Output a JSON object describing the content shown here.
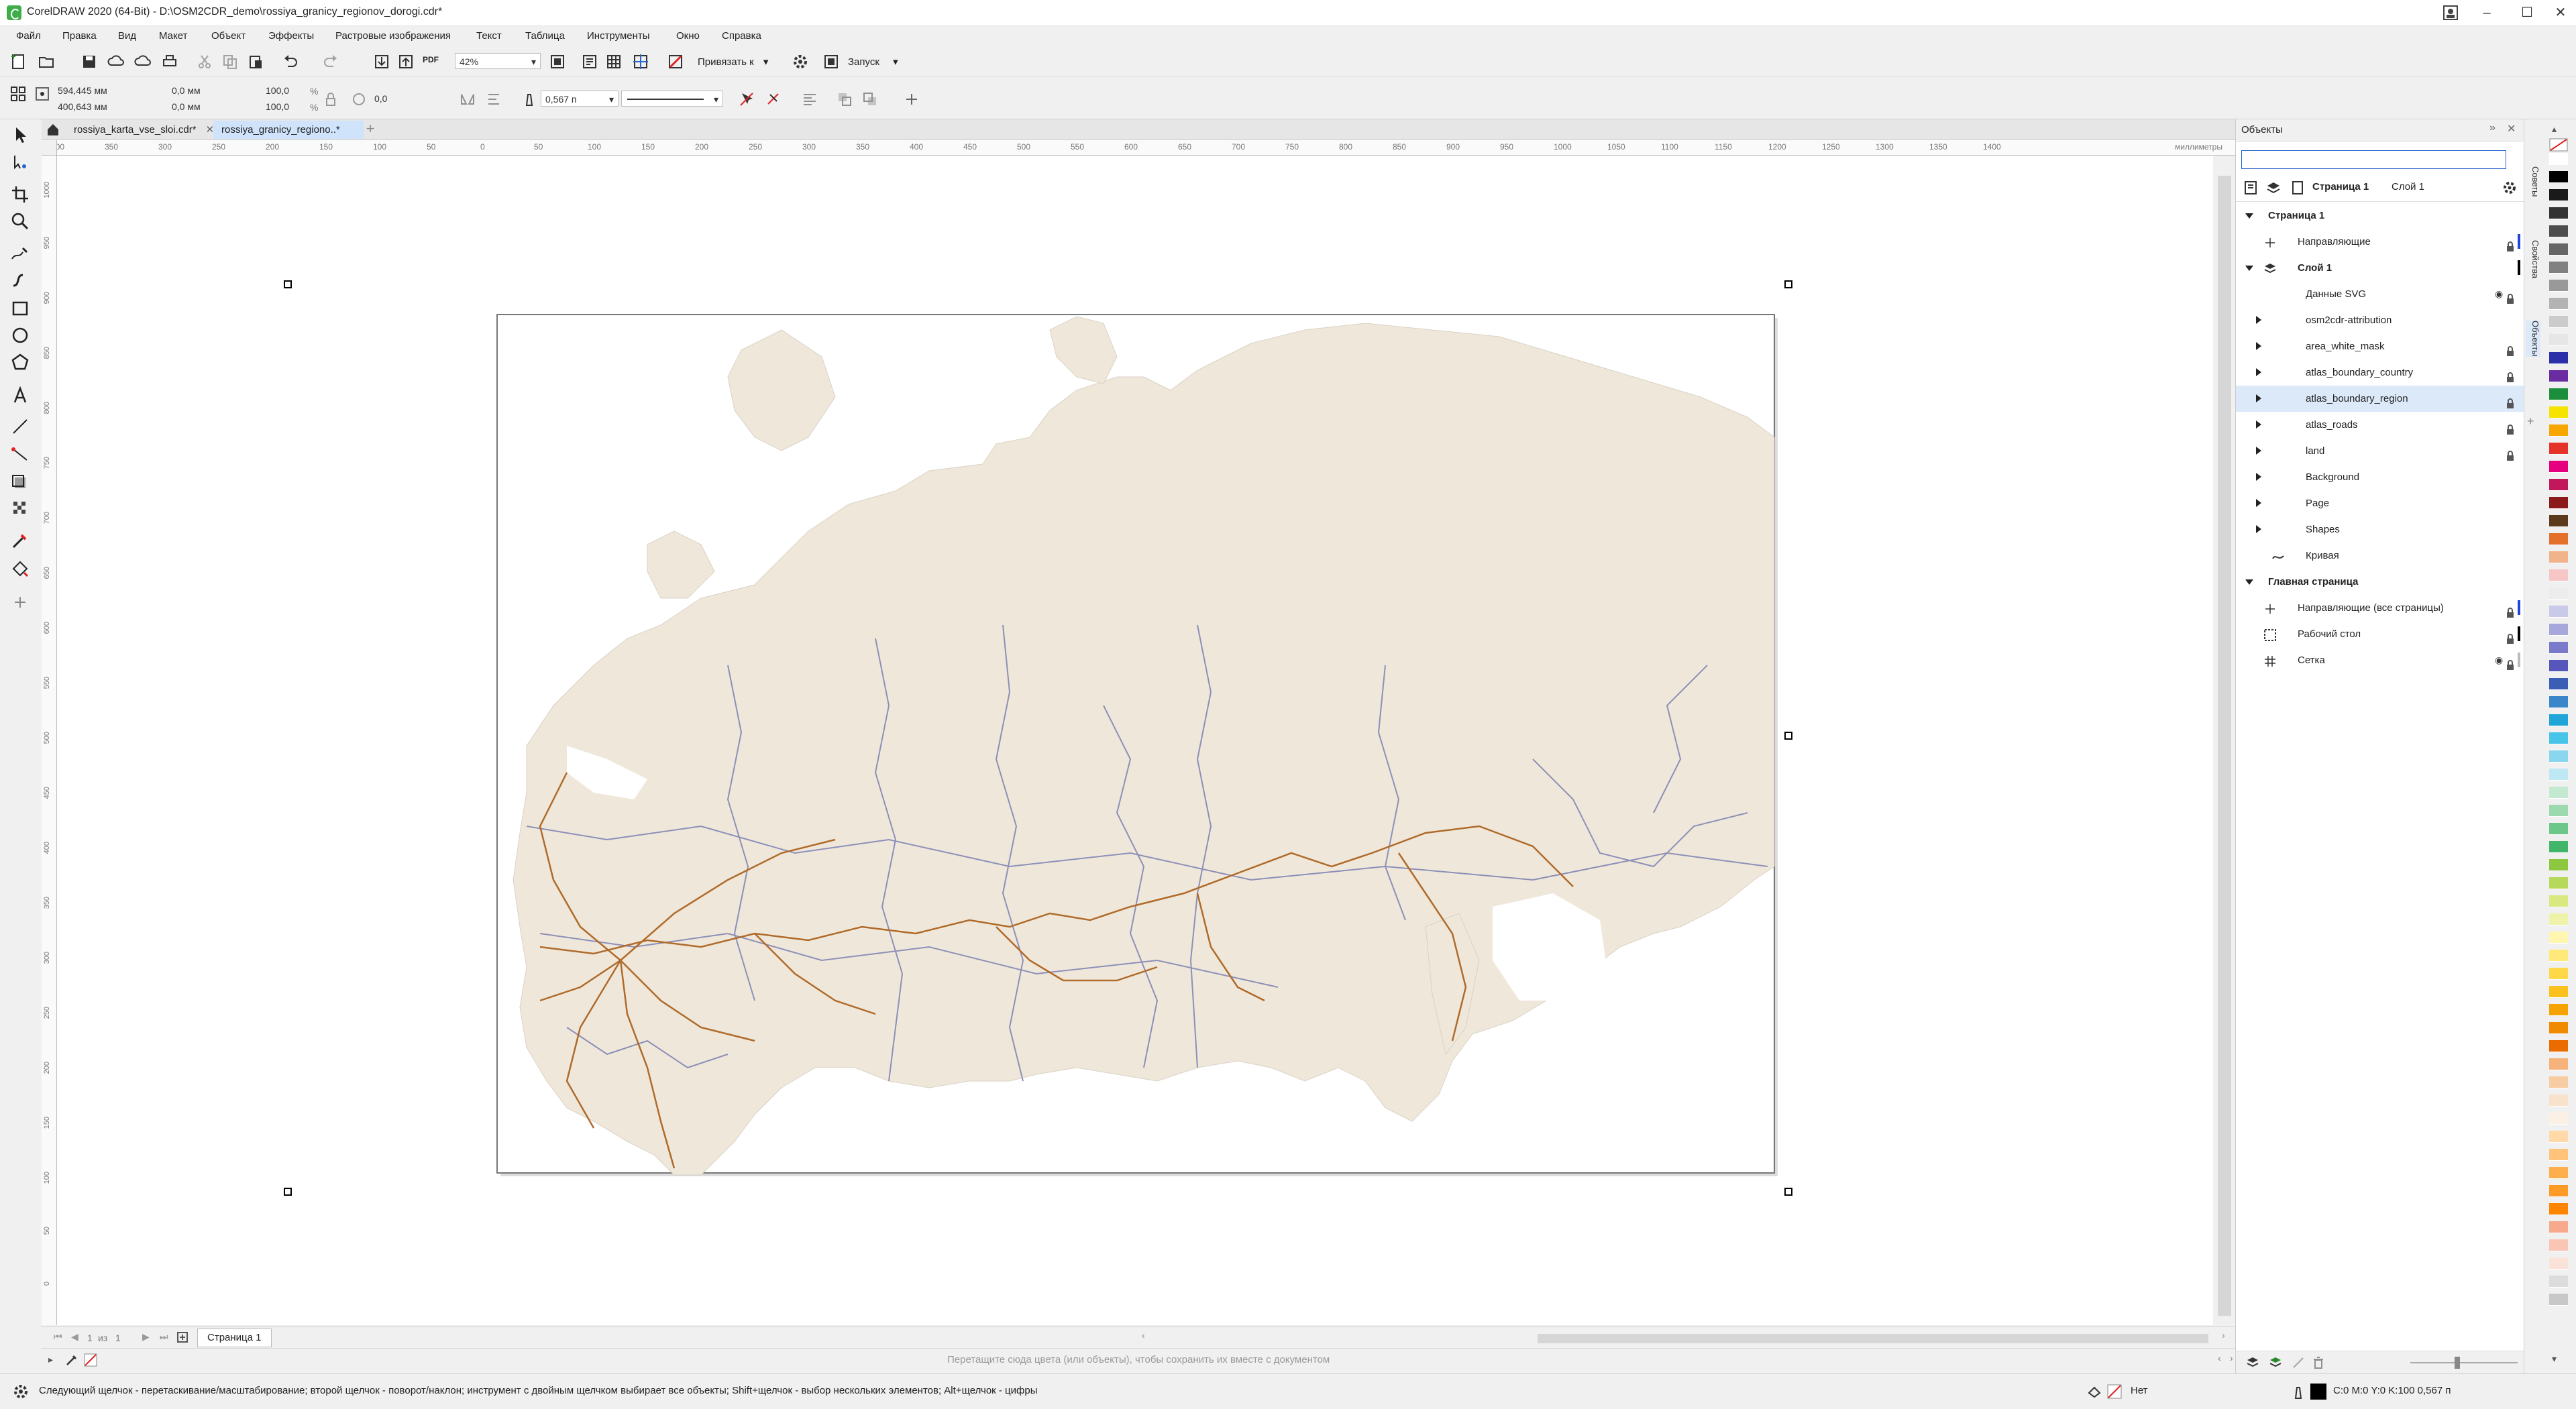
{
  "window": {
    "title": "CorelDRAW 2020 (64-Bit) - D:\\OSM2CDR_demo\\rossiya_granicy_regionov_dorogi.cdr*",
    "minimize": "–",
    "maximize": "☐",
    "close": "✕"
  },
  "menu": [
    "Файл",
    "Правка",
    "Вид",
    "Макет",
    "Объект",
    "Эффекты",
    "Растровые изображения",
    "Текст",
    "Таблица",
    "Инструменты",
    "Окно",
    "Справка"
  ],
  "toolbar": {
    "zoom": "42%",
    "snap_label": "Привязать к",
    "launch_label": "Запуск",
    "pdf_label": "PDF"
  },
  "property_bar": {
    "x": "594,445 мм",
    "y": "400,643 мм",
    "w": "0,0 мм",
    "h": "0,0 мм",
    "scale_x": "100,0",
    "scale_y": "100,0",
    "pct1": "%",
    "pct2": "%",
    "angle": "0,0",
    "outline_width": "0,567 п"
  },
  "doc_tabs": [
    "rossiya_karta_vse_sloi.cdr*",
    "rossiya_granicy_regiono..*"
  ],
  "ruler": {
    "unit": "миллиметры",
    "h_ticks": [
      "400",
      "350",
      "300",
      "250",
      "200",
      "150",
      "100",
      "50",
      "0",
      "50",
      "100",
      "150",
      "200",
      "250",
      "300",
      "350",
      "400",
      "450",
      "500",
      "550",
      "600",
      "650",
      "700",
      "750",
      "800",
      "850",
      "900",
      "950",
      "1000",
      "1050",
      "1100",
      "1150",
      "1200",
      "1250",
      "1300",
      "1350",
      "1400"
    ],
    "v_ticks": [
      "1000",
      "950",
      "900",
      "850",
      "800",
      "750",
      "700",
      "650",
      "600",
      "550",
      "500",
      "450",
      "400",
      "350",
      "300",
      "250",
      "200",
      "150",
      "100",
      "50",
      "0"
    ]
  },
  "page_nav": {
    "current": "1",
    "of": "из",
    "total": "1",
    "page_tab": "Страница 1"
  },
  "palette_hint": "Перетащите сюда цвета (или объекты), чтобы сохранить их вместе с документом",
  "status": {
    "message": "Следующий щелчок - перетаскивание/масштабирование; второй щелчок - поворот/наклон; инструмент с двойным щелчком выбирает все объекты; Shift+щелчок - выбор нескольких элементов; Alt+щелчок - цифры",
    "fill": "Нет",
    "outline": "C:0 M:0 Y:0 K:100  0,567 п"
  },
  "objects_docker": {
    "title": "Объекты",
    "search_placeholder": "",
    "page_label": "Страница 1",
    "layer_label": "Слой 1",
    "tree": [
      {
        "label": "Страница 1",
        "level": 0,
        "expander": "down",
        "bold": true
      },
      {
        "label": "Направляющие",
        "level": 1,
        "expander": "none",
        "icon": "guides",
        "lock": true,
        "chip": "#2244dd"
      },
      {
        "label": "Слой 1",
        "level": 1,
        "expander": "down",
        "bold": true,
        "icon": "layer",
        "chip": "#000000"
      },
      {
        "label": "Данные SVG",
        "level": 2,
        "expander": "none",
        "eye": true,
        "lock": true
      },
      {
        "label": "osm2cdr-attribution",
        "level": 2,
        "expander": "right"
      },
      {
        "label": "area_white_mask",
        "level": 2,
        "expander": "right",
        "lock": true
      },
      {
        "label": "atlas_boundary_country",
        "level": 2,
        "expander": "right",
        "lock": true
      },
      {
        "label": "atlas_boundary_region",
        "level": 2,
        "expander": "right",
        "lock": true,
        "selected": true
      },
      {
        "label": "atlas_roads",
        "level": 2,
        "expander": "right",
        "lock": true
      },
      {
        "label": "land",
        "level": 2,
        "expander": "right",
        "lock": true
      },
      {
        "label": "Background",
        "level": 2,
        "expander": "right"
      },
      {
        "label": "Page",
        "level": 2,
        "expander": "right"
      },
      {
        "label": "Shapes",
        "level": 2,
        "expander": "right"
      },
      {
        "label": "Кривая",
        "level": 2,
        "expander": "none",
        "icon": "curve"
      },
      {
        "label": "Главная страница",
        "level": 0,
        "expander": "down",
        "bold": true
      },
      {
        "label": "Направляющие (все страницы)",
        "level": 1,
        "expander": "none",
        "icon": "guides",
        "lock": true,
        "chip": "#2244dd"
      },
      {
        "label": "Рабочий стол",
        "level": 1,
        "expander": "none",
        "icon": "desktop",
        "lock": true,
        "chip": "#000000"
      },
      {
        "label": "Сетка",
        "level": 1,
        "expander": "none",
        "icon": "grid",
        "eye": true,
        "lock": true,
        "chip": "#bbbbbb"
      }
    ]
  },
  "side_tabs": [
    "Советы",
    "Свойства",
    "Объекты"
  ],
  "palette": [
    "#ffffff",
    "#000000",
    "#1a1a1a",
    "#333333",
    "#4d4d4d",
    "#666666",
    "#808080",
    "#999999",
    "#b3b3b3",
    "#cccccc",
    "#e6e6e6",
    "#2b2fa8",
    "#6a2ca0",
    "#1d8f3c",
    "#f4e400",
    "#f7a700",
    "#e6332a",
    "#e5007e",
    "#c2185b",
    "#8b1a1a",
    "#5a3a1a",
    "#e3702b",
    "#f1b48a",
    "#f6c6c6",
    "#ececec",
    "#c9c9e9",
    "#a7a7dc",
    "#7a7acb",
    "#5555bb",
    "#3a5db5",
    "#3a86c8",
    "#1fa5d8",
    "#48c4e8",
    "#8bd6ef",
    "#bfe8f5",
    "#c3ead0",
    "#9bd9ae",
    "#6cc788",
    "#42b668",
    "#8dc63f",
    "#b6d95b",
    "#d9e87f",
    "#eef3a9",
    "#fff7b0",
    "#ffe97a",
    "#ffd84a",
    "#fbc21f",
    "#f4a300",
    "#f08a00",
    "#ea6b00",
    "#f5b27a",
    "#f7cca3",
    "#f9e2cc",
    "#fcefe3",
    "#ffd9a8",
    "#ffc37a",
    "#ffae4d",
    "#ff9a26",
    "#ff8400",
    "#f7a98c",
    "#f9c6b5",
    "#fbe2d9",
    "#dcdcdc",
    "#c8c8c8"
  ]
}
